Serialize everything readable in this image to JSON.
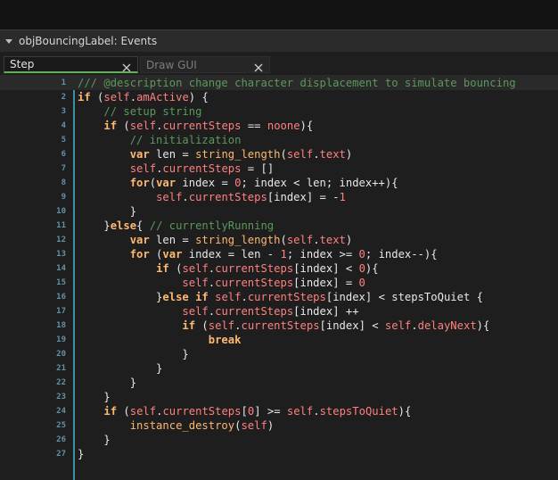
{
  "window": {
    "title": "objBouncingLabel: Events"
  },
  "tabs": [
    {
      "label": "Step",
      "active": true
    },
    {
      "label": "Draw GUI",
      "active": false
    }
  ],
  "editor": {
    "caret_marker": ">",
    "lines": [
      {
        "n": "1",
        "tokens": [
          [
            "cm",
            "/// "
          ],
          [
            "cm",
            "@description change character displacement to simulate bouncing"
          ]
        ]
      },
      {
        "n": "2",
        "tokens": [
          [
            "kw",
            "if"
          ],
          [
            "tx",
            " ("
          ],
          [
            "sf",
            "self"
          ],
          [
            "tx",
            "."
          ],
          [
            "sf",
            "amActive"
          ],
          [
            "tx",
            ") {"
          ]
        ]
      },
      {
        "n": "3",
        "tokens": [
          [
            "tx",
            "    "
          ],
          [
            "cm",
            "// setup string"
          ]
        ]
      },
      {
        "n": "4",
        "tokens": [
          [
            "tx",
            "    "
          ],
          [
            "kw",
            "if"
          ],
          [
            "tx",
            " ("
          ],
          [
            "sf",
            "self"
          ],
          [
            "tx",
            "."
          ],
          [
            "sf",
            "currentSteps"
          ],
          [
            "tx",
            " == "
          ],
          [
            "ct",
            "noone"
          ],
          [
            "tx",
            "){"
          ]
        ]
      },
      {
        "n": "5",
        "tokens": [
          [
            "tx",
            "        "
          ],
          [
            "cm",
            "// initialization"
          ]
        ]
      },
      {
        "n": "6",
        "tokens": [
          [
            "tx",
            "        "
          ],
          [
            "kw",
            "var"
          ],
          [
            "tx",
            " len = "
          ],
          [
            "fn",
            "string_length"
          ],
          [
            "tx",
            "("
          ],
          [
            "sf",
            "self"
          ],
          [
            "tx",
            "."
          ],
          [
            "sf",
            "text"
          ],
          [
            "tx",
            ")"
          ]
        ]
      },
      {
        "n": "7",
        "tokens": [
          [
            "tx",
            "        "
          ],
          [
            "sf",
            "self"
          ],
          [
            "tx",
            "."
          ],
          [
            "sf",
            "currentSteps"
          ],
          [
            "tx",
            " = []"
          ]
        ]
      },
      {
        "n": "8",
        "tokens": [
          [
            "tx",
            "        "
          ],
          [
            "kw",
            "for"
          ],
          [
            "tx",
            "("
          ],
          [
            "kw",
            "var"
          ],
          [
            "tx",
            " index = "
          ],
          [
            "nm",
            "0"
          ],
          [
            "tx",
            "; index < len; index++){"
          ]
        ]
      },
      {
        "n": "9",
        "tokens": [
          [
            "tx",
            "            "
          ],
          [
            "sf",
            "self"
          ],
          [
            "tx",
            "."
          ],
          [
            "sf",
            "currentSteps"
          ],
          [
            "tx",
            "[index] = -"
          ],
          [
            "nm",
            "1"
          ]
        ]
      },
      {
        "n": "10",
        "tokens": [
          [
            "tx",
            "        }"
          ]
        ]
      },
      {
        "n": "11",
        "tokens": [
          [
            "tx",
            "    }"
          ],
          [
            "kw",
            "else"
          ],
          [
            "tx",
            "{ "
          ],
          [
            "cm",
            "// currentlyRunning"
          ]
        ]
      },
      {
        "n": "12",
        "tokens": [
          [
            "tx",
            "        "
          ],
          [
            "kw",
            "var"
          ],
          [
            "tx",
            " len = "
          ],
          [
            "fn",
            "string_length"
          ],
          [
            "tx",
            "("
          ],
          [
            "sf",
            "self"
          ],
          [
            "tx",
            "."
          ],
          [
            "sf",
            "text"
          ],
          [
            "tx",
            ")"
          ]
        ]
      },
      {
        "n": "13",
        "tokens": [
          [
            "tx",
            "        "
          ],
          [
            "kw",
            "for"
          ],
          [
            "tx",
            " ("
          ],
          [
            "kw",
            "var"
          ],
          [
            "tx",
            " index = len - "
          ],
          [
            "nm",
            "1"
          ],
          [
            "tx",
            "; index >= "
          ],
          [
            "nm",
            "0"
          ],
          [
            "tx",
            "; index--){"
          ]
        ]
      },
      {
        "n": "14",
        "tokens": [
          [
            "tx",
            "            "
          ],
          [
            "kw",
            "if"
          ],
          [
            "tx",
            " ("
          ],
          [
            "sf",
            "self"
          ],
          [
            "tx",
            "."
          ],
          [
            "sf",
            "currentSteps"
          ],
          [
            "tx",
            "[index] < "
          ],
          [
            "nm",
            "0"
          ],
          [
            "tx",
            "){"
          ]
        ]
      },
      {
        "n": "15",
        "tokens": [
          [
            "tx",
            "                "
          ],
          [
            "sf",
            "self"
          ],
          [
            "tx",
            "."
          ],
          [
            "sf",
            "currentSteps"
          ],
          [
            "tx",
            "[index] = "
          ],
          [
            "nm",
            "0"
          ]
        ]
      },
      {
        "n": "16",
        "tokens": [
          [
            "tx",
            "            }"
          ],
          [
            "kw",
            "else if"
          ],
          [
            "tx",
            " "
          ],
          [
            "sf",
            "self"
          ],
          [
            "tx",
            "."
          ],
          [
            "sf",
            "currentSteps"
          ],
          [
            "tx",
            "[index] < stepsToQuiet {"
          ]
        ]
      },
      {
        "n": "17",
        "tokens": [
          [
            "tx",
            "                "
          ],
          [
            "sf",
            "self"
          ],
          [
            "tx",
            "."
          ],
          [
            "sf",
            "currentSteps"
          ],
          [
            "tx",
            "[index] ++"
          ]
        ]
      },
      {
        "n": "18",
        "tokens": [
          [
            "tx",
            "                "
          ],
          [
            "kw",
            "if"
          ],
          [
            "tx",
            " ("
          ],
          [
            "sf",
            "self"
          ],
          [
            "tx",
            "."
          ],
          [
            "sf",
            "currentSteps"
          ],
          [
            "tx",
            "[index] < "
          ],
          [
            "sf",
            "self"
          ],
          [
            "tx",
            "."
          ],
          [
            "sf",
            "delayNext"
          ],
          [
            "tx",
            "){"
          ]
        ]
      },
      {
        "n": "19",
        "tokens": [
          [
            "tx",
            "                    "
          ],
          [
            "kw",
            "break"
          ]
        ]
      },
      {
        "n": "20",
        "tokens": [
          [
            "tx",
            "                }"
          ]
        ]
      },
      {
        "n": "21",
        "tokens": [
          [
            "tx",
            "            }"
          ]
        ]
      },
      {
        "n": "22",
        "tokens": [
          [
            "tx",
            "        }"
          ]
        ]
      },
      {
        "n": "23",
        "tokens": [
          [
            "tx",
            "    }"
          ]
        ]
      },
      {
        "n": "24",
        "tokens": [
          [
            "tx",
            "    "
          ],
          [
            "kw",
            "if"
          ],
          [
            "tx",
            " ("
          ],
          [
            "sf",
            "self"
          ],
          [
            "tx",
            "."
          ],
          [
            "sf",
            "currentSteps"
          ],
          [
            "tx",
            "["
          ],
          [
            "nm",
            "0"
          ],
          [
            "tx",
            "] >= "
          ],
          [
            "sf",
            "self"
          ],
          [
            "tx",
            "."
          ],
          [
            "sf",
            "stepsToQuiet"
          ],
          [
            "tx",
            "){"
          ]
        ]
      },
      {
        "n": "25",
        "tokens": [
          [
            "tx",
            "        "
          ],
          [
            "fn",
            "instance_destroy"
          ],
          [
            "tx",
            "("
          ],
          [
            "sf",
            "self"
          ],
          [
            "tx",
            ")"
          ]
        ]
      },
      {
        "n": "26",
        "tokens": [
          [
            "tx",
            "    }"
          ]
        ]
      },
      {
        "n": "27",
        "tokens": [
          [
            "tx",
            "}"
          ]
        ]
      }
    ]
  },
  "colors": {
    "background": "#1e1e1e",
    "gutter_accent": "#3a8fa3",
    "active_tab_underline": "#64b05a",
    "keyword": "#ffb871",
    "comment": "#5b995b",
    "number": "#ff8080"
  },
  "icons": {
    "collapse": "triangle-down-icon",
    "tab_close": "close-icon"
  }
}
